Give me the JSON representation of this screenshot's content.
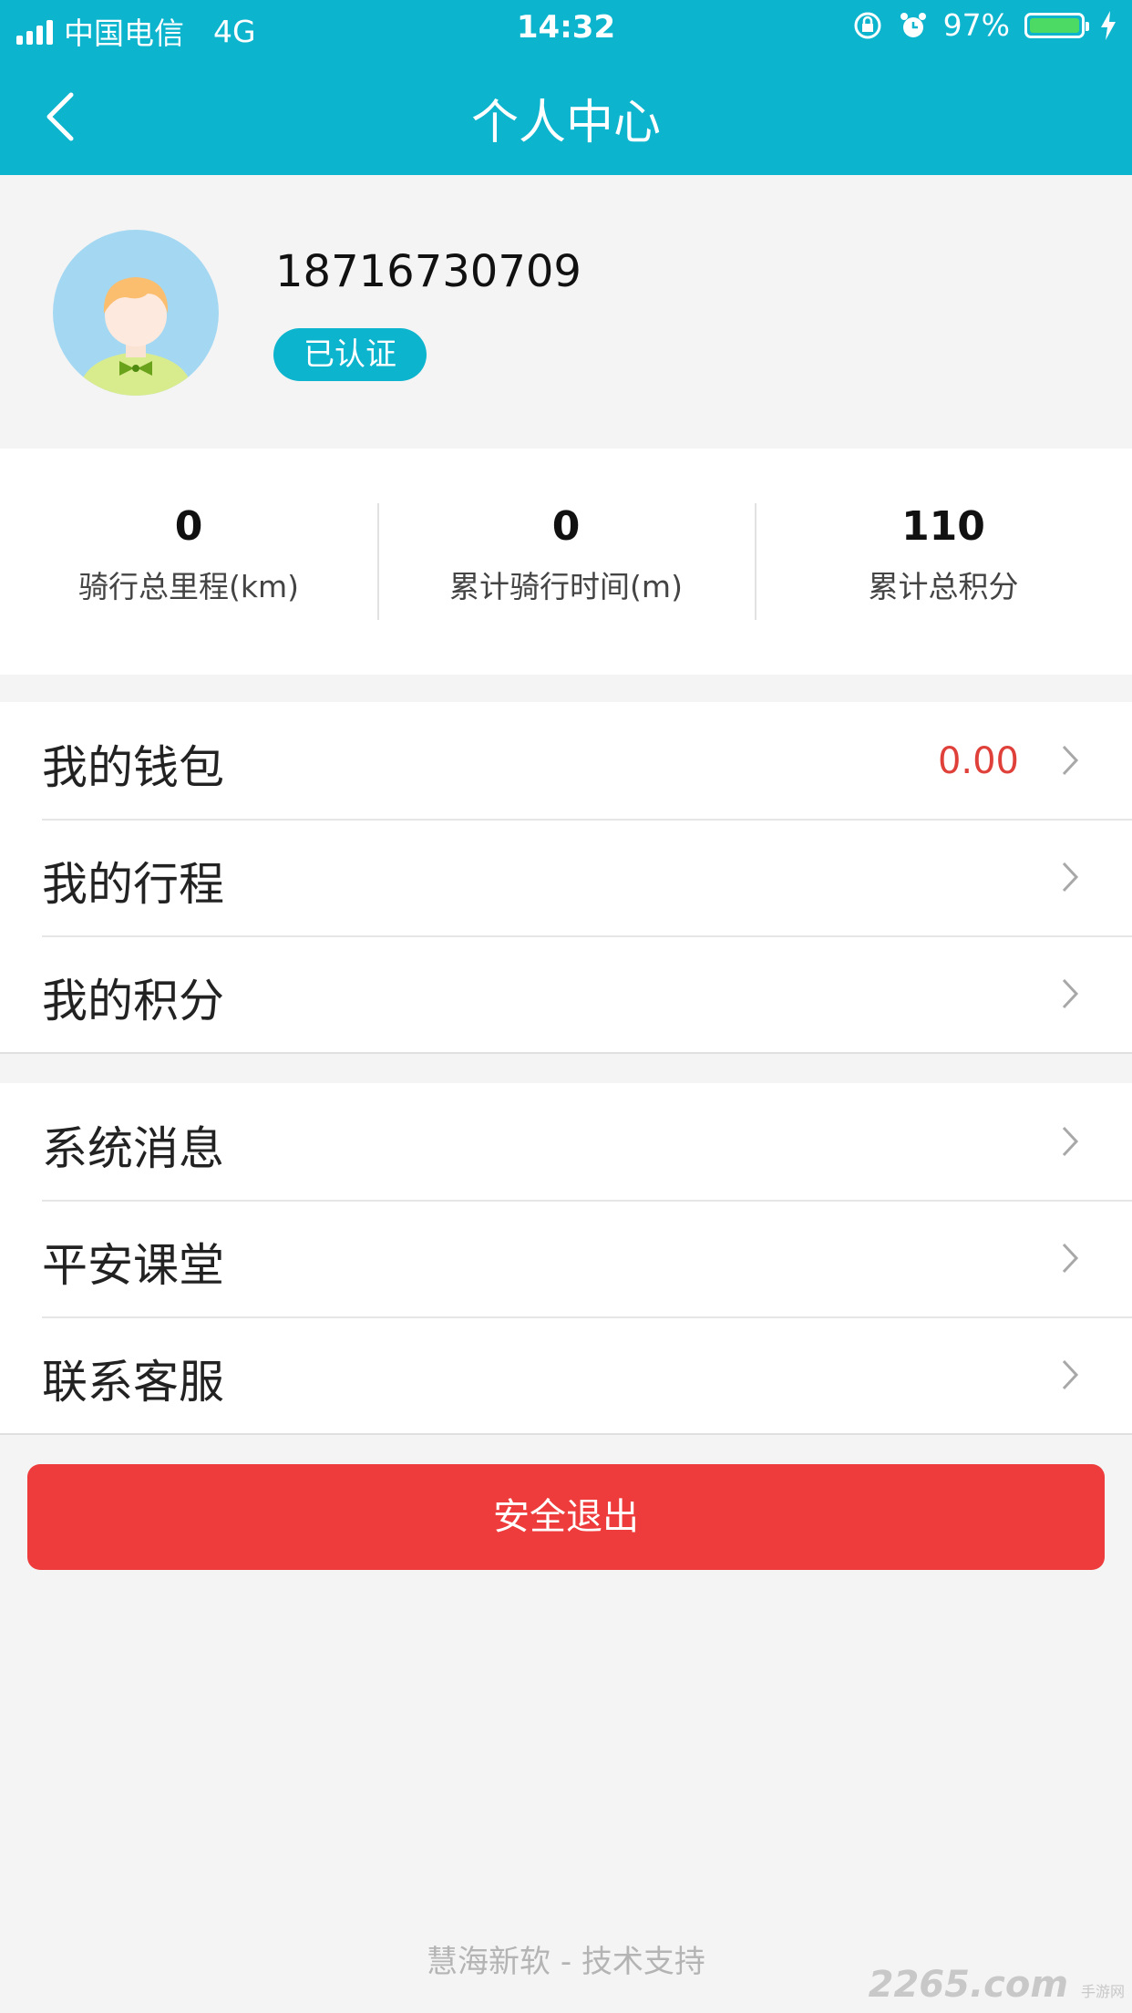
{
  "status_bar": {
    "carrier": "中国电信",
    "network": "4G",
    "time": "14:32",
    "battery": "97%"
  },
  "header": {
    "title": "个人中心",
    "back_icon": "chevron-left-icon",
    "background": "#0db4ce"
  },
  "profile": {
    "phone": "18716730709",
    "verified_label": "已认证"
  },
  "stats": [
    {
      "value": "0",
      "label": "骑行总里程(km)"
    },
    {
      "value": "0",
      "label": "累计骑行时间(m)"
    },
    {
      "value": "110",
      "label": "累计总积分"
    }
  ],
  "menu_group_1": [
    {
      "label": "我的钱包",
      "value": "0.00"
    },
    {
      "label": "我的行程"
    },
    {
      "label": "我的积分"
    }
  ],
  "menu_group_2": [
    {
      "label": "系统消息"
    },
    {
      "label": "平安课堂"
    },
    {
      "label": "联系客服"
    }
  ],
  "logout_label": "安全退出",
  "footer": "慧海新软 - 技术支持",
  "watermark": {
    "brand": "2265",
    "suffix": ".com",
    "tag": "手游网"
  },
  "colors": {
    "accent": "#0db4ce",
    "danger": "#ee3b3b",
    "value_red": "#e0403a"
  }
}
